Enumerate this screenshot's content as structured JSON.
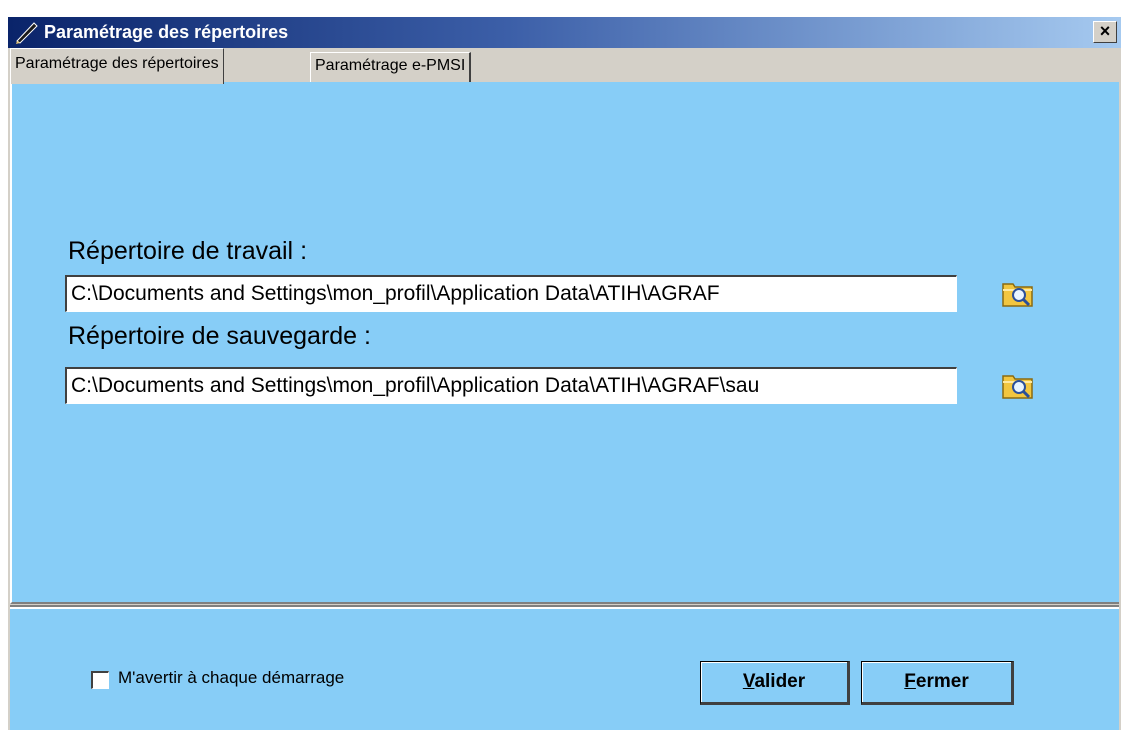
{
  "window": {
    "title": "Paramétrage des répertoires",
    "close_label": "×"
  },
  "tabs": [
    {
      "label": "Paramétrage des répertoires",
      "active": true
    },
    {
      "label": "Paramétrage e-PMSI",
      "active": false
    }
  ],
  "working_dir": {
    "label_main": "Répertoire de travail",
    "label_suffix": " :",
    "value": "C:\\Documents and Settings\\mon_profil\\Application Data\\ATIH\\AGRAF",
    "browse_icon": "folder-search-icon"
  },
  "backup_dir": {
    "label_main": "Répertoire de sauvegarde",
    "label_suffix": " :",
    "value": "C:\\Documents and Settings\\mon_profil\\Application Data\\ATIH\\AGRAF\\sau",
    "browse_icon": "folder-search-icon"
  },
  "footer": {
    "checkbox_label": "M'avertir à chaque démarrage",
    "checkbox_checked": false,
    "validate_button": {
      "accel": "V",
      "rest": "alider"
    },
    "close_button": {
      "accel": "F",
      "rest": "ermer"
    }
  },
  "colors": {
    "panel": "#87cdf7",
    "titlebar_start": "#0a246a",
    "titlebar_end": "#a6caf0",
    "chrome": "#d4d0c8"
  }
}
